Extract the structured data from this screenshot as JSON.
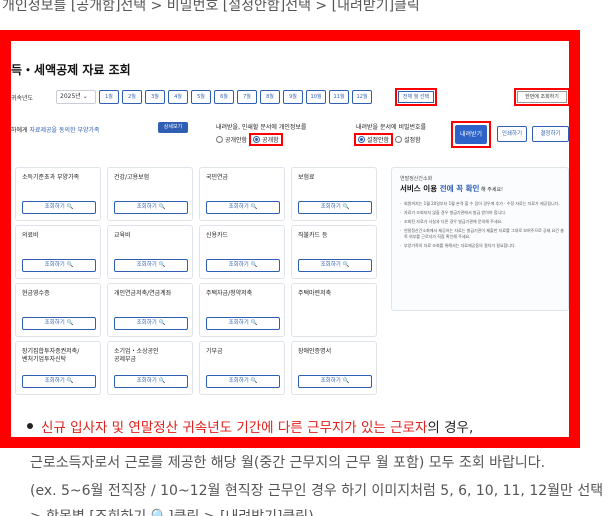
{
  "top_caption": "개인정보를 [공개함]선택 > 비밀번호 [설정안함]선택 > [내려받기]클릭",
  "screen": {
    "title": "득・세액공제 자료 조회",
    "year_label": "귀속년도",
    "year_value": "2025년 ⌄",
    "months": [
      "1월",
      "2월",
      "3월",
      "4월",
      "5월",
      "6월",
      "7월",
      "8월",
      "9월",
      "10월",
      "11월",
      "12월"
    ],
    "all_year_btn": "전체 월 선택",
    "one_page_btn": "한번에 조회하기",
    "consent": {
      "prefix": "하에게 ",
      "highlight": "자료제공을 동의한 부양가족",
      "detail_btn": "상세보기"
    },
    "privacy_group": {
      "title": "내려받을, 인쇄할 문서에 개인정보를",
      "opt_off": "공개안함",
      "opt_on": "공개함"
    },
    "password_group": {
      "title": "내려받을 문서에 비밀번호를",
      "opt_on": "설정안함",
      "opt_off": "설정함"
    },
    "download_btn": "내려받기",
    "print_btn": "인쇄하기",
    "save_btn": "결정하기",
    "view_btn": "조회하기 🔍",
    "cards": [
      {
        "title": "소득기준초과 부양가족"
      },
      {
        "title": "건강/고용보험"
      },
      {
        "title": "국민연금"
      },
      {
        "title": "보험료"
      },
      {
        "title": "의료비"
      },
      {
        "title": "교육비"
      },
      {
        "title": "신용카드"
      },
      {
        "title": "직불카드 등"
      },
      {
        "title": "현금영수증"
      },
      {
        "title": "개인연금저축/연금계좌"
      },
      {
        "title": "주택자금/청약저축"
      },
      {
        "title": "주택마련저축"
      },
      {
        "title": "장기집합투자증권저축/\n벤처기업투자신탁"
      },
      {
        "title": "소기업・소상공인\n공제부금"
      },
      {
        "title": "기부금"
      },
      {
        "title": "장애인증명서"
      }
    ],
    "info": {
      "kicker": "연말정산간소화",
      "head_pre": "서비스 이용 ",
      "head_blue": "전에 꼭 확인",
      "head_post": " 해 주세요!",
      "items": [
        "회원까지는 1월 20일부터 1월 본격 할 수 있어 경우에 추가 · 수정 자료는 자료가 제공됩니다.",
        "자료가 조회되지 않을 경우 발급기관에서 발급 받아야 합니다.",
        "조회된 자료가 사실과 다른 경우 발급기관에 문의해 주세요.",
        "연말정산간소화에서 제공하는 자료는 발급기관이 제출한 자료를 그대로 보여주므로 공제 요건 충족 여부를 근로자가 직접 확인해 주세요.",
        "부양가족의 자료 조회를 위해서는 자료제공동의 절차가 필요합니다."
      ]
    }
  },
  "bullet": {
    "red": "신규 입사자 및 연말정산 귀속년도 기간에 다른 근무지가 있는 근로자",
    "rest": "의 경우,"
  },
  "para_line1": "근로소득자로서 근로를 제공한 해당 월(중간 근무지의 근무 월 포함) 모두 조회 바랍니다.",
  "para_line2": "(ex. 5~6월 전직장 / 10~12월 현직장 근무인 경우 하기 이미지처럼 5, 6, 10, 11, 12월만 선택",
  "para_line3": "> 항목별 [조회하기 🔍]클릭 > [내려받기]클릭)"
}
